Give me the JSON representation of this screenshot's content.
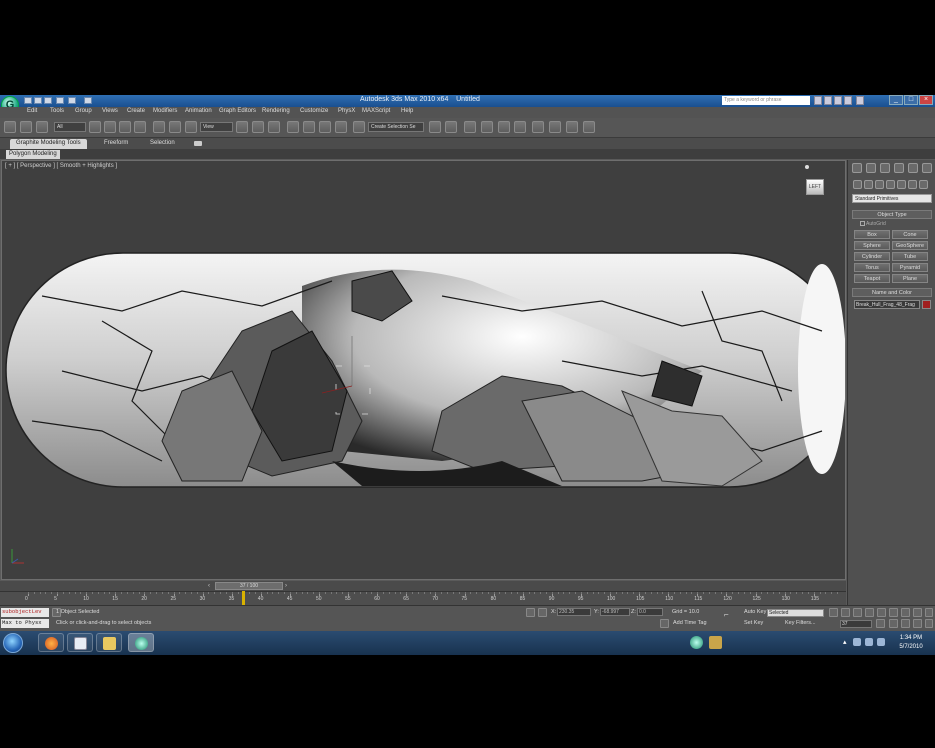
{
  "app": {
    "title": "Autodesk 3ds Max 2010 x64",
    "document": "Untitled"
  },
  "help_search": {
    "placeholder": "Type a keyword or phrase"
  },
  "menu": [
    "Edit",
    "Tools",
    "Group",
    "Views",
    "Create",
    "Modifiers",
    "Animation",
    "Graph Editors",
    "Rendering",
    "Customize",
    "PhysX",
    "MAXScript",
    "Help"
  ],
  "toolbar": {
    "selection_filter": "All",
    "ref_coord": "View",
    "named_selection": "Create Selection Se"
  },
  "ribbon": {
    "tabs": [
      "Graphite Modeling Tools",
      "Freeform",
      "Selection"
    ],
    "panel": "Polygon Modeling"
  },
  "viewport": {
    "label": "[ + ] [ Perspective ] [ Smooth + Highlights ]",
    "viewcube": "LEFT"
  },
  "command_panel": {
    "category": "Standard Primitives",
    "object_type_title": "Object Type",
    "autogrid": "AutoGrid",
    "primitives": [
      "Box",
      "Cone",
      "Sphere",
      "GeoSphere",
      "Cylinder",
      "Tube",
      "Torus",
      "Pyramid",
      "Teapot",
      "Plane"
    ],
    "name_color_title": "Name and Color",
    "object_name": "Break_Hull_Frag_48_Frag",
    "object_color": "#a02020"
  },
  "timeline": {
    "slider": "37 / 100",
    "current_frame": 37,
    "total_frames": 100,
    "ticks": [
      "0",
      "5",
      "10",
      "15",
      "20",
      "25",
      "30",
      "35",
      "40",
      "45",
      "50",
      "55",
      "60",
      "65",
      "70",
      "75",
      "80",
      "85",
      "90",
      "95",
      "100",
      "105",
      "110",
      "115",
      "120",
      "125",
      "130",
      "135"
    ]
  },
  "status": {
    "maxscript_line1": "subobjectLev",
    "maxscript_line2": "Max to Physx",
    "selection": "1 Object Selected",
    "prompt": "Click or click-and-drag to select objects",
    "x_label": "X:",
    "x_value": "230.35",
    "y_label": "Y:",
    "y_value": "-68.997",
    "z_label": "Z:",
    "z_value": "0.0",
    "grid": "Grid = 10.0",
    "add_time_tag": "Add Time Tag",
    "auto_key": "Auto Key",
    "set_key": "Set Key",
    "key_mode": "Selected",
    "key_filters": "Key Filters...",
    "frame": "37"
  },
  "taskbar": {
    "time": "1:34 PM",
    "date": "5/7/2010"
  },
  "colors": {
    "title_bar": "#2a62a6",
    "ui_gray": "#555555",
    "viewport_bg": "#3f3f3f",
    "playhead": "#d9b200"
  }
}
